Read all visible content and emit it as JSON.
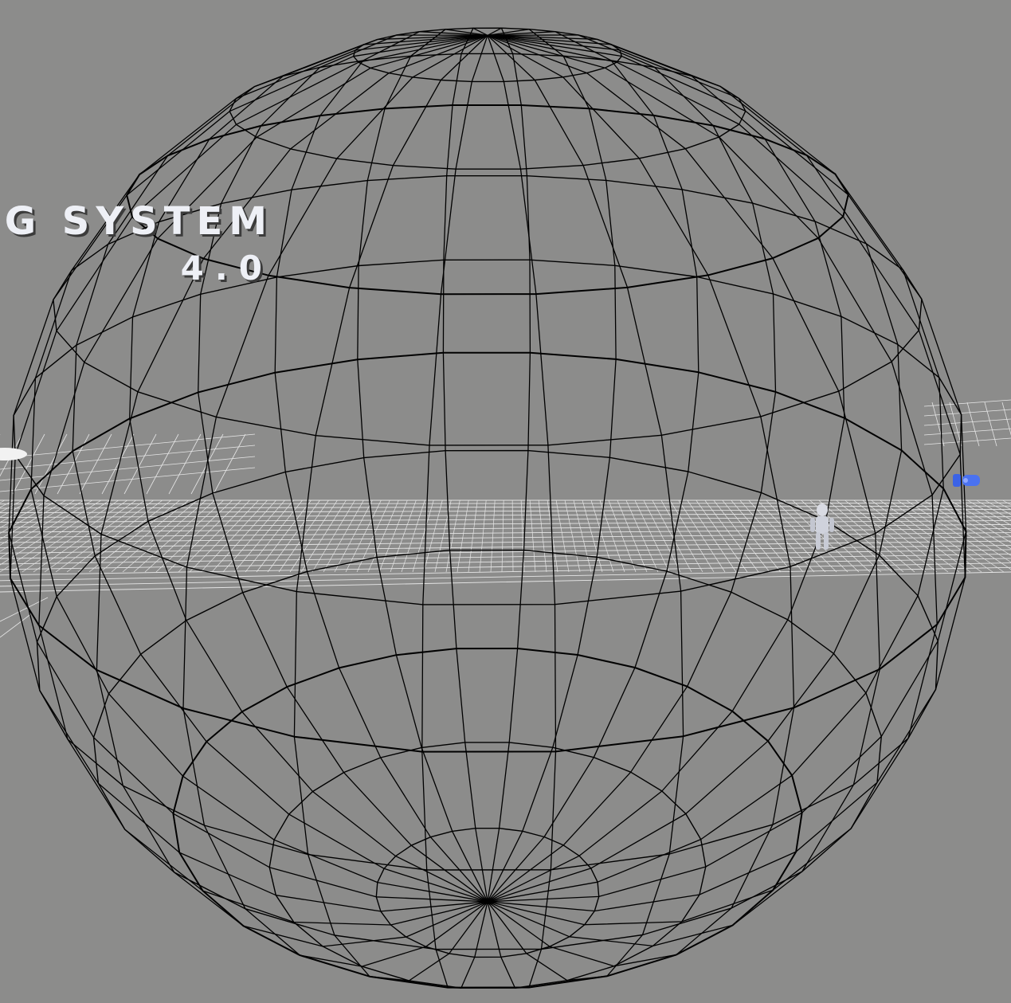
{
  "viewport": {
    "background": "#8c8c8b",
    "wire_color": "#000000",
    "grid_color": "#e6e6e6",
    "actor_color": "#3b63e6"
  },
  "title": {
    "line1": "NG SYSTEM",
    "line2": "4.0"
  },
  "sphere": {
    "rings": 12,
    "segments": 28,
    "label": "wireframe-sphere"
  },
  "icons": {
    "character": "mannequin-character-icon",
    "blue_actor": "blue-actor-icon",
    "floor_grid": "floor-grid"
  }
}
